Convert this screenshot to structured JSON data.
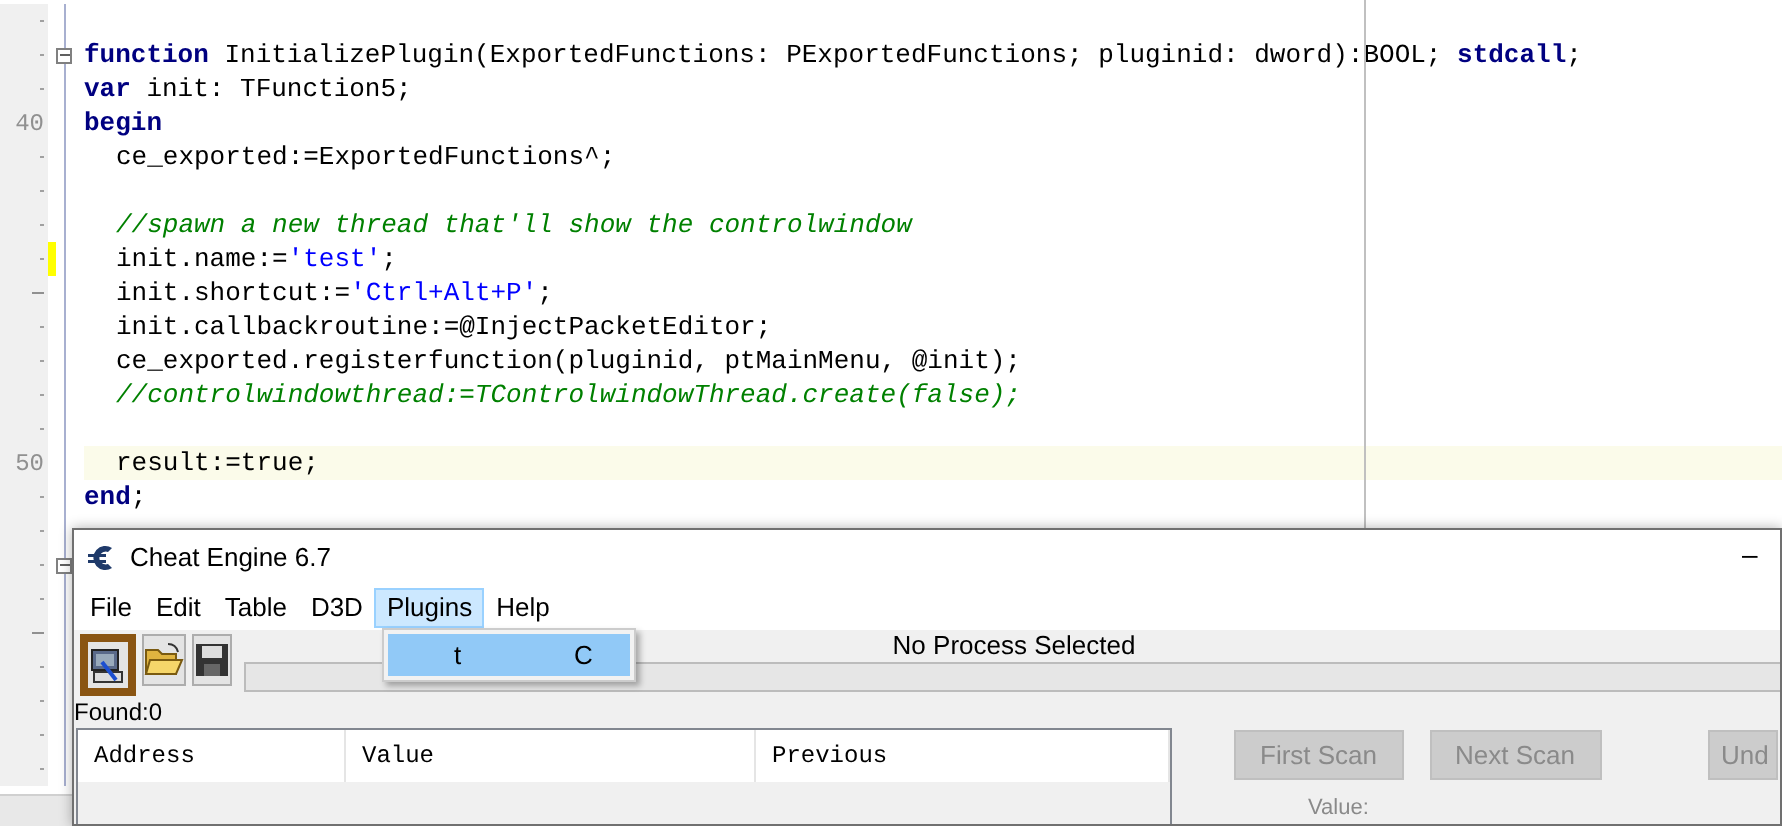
{
  "editor": {
    "lines": [
      {
        "kind": "dot"
      },
      {
        "kind": "dot",
        "fold": true,
        "tokens": [
          {
            "kind": "keyword",
            "text": "function"
          },
          {
            "kind": "plain",
            "text": " InitializePlugin(ExportedFunctions: PExportedFunctions; pluginid: dword):BOOL; "
          },
          {
            "kind": "keyword",
            "text": "stdcall"
          },
          {
            "kind": "plain",
            "text": ";"
          }
        ]
      },
      {
        "kind": "dot",
        "tokens": [
          {
            "kind": "keyword",
            "text": "var"
          },
          {
            "kind": "plain",
            "text": " init: TFunction5;"
          }
        ]
      },
      {
        "number": "40",
        "tokens": [
          {
            "kind": "keyword",
            "text": "begin"
          }
        ]
      },
      {
        "kind": "dot",
        "indented": true,
        "tokens": [
          {
            "kind": "plain",
            "text": "ce_exported:=ExportedFunctions^;"
          }
        ]
      },
      {
        "kind": "dot"
      },
      {
        "kind": "dot",
        "indented": true,
        "tokens": [
          {
            "kind": "comment",
            "text": "//spawn a new thread that'll show the controlwindow"
          }
        ]
      },
      {
        "kind": "dot",
        "indented": true,
        "modified": true,
        "tokens": [
          {
            "kind": "plain",
            "text": "init.name:="
          },
          {
            "kind": "string",
            "text": "'test'"
          },
          {
            "kind": "plain",
            "text": ";"
          }
        ]
      },
      {
        "kind": "dash",
        "indented": true,
        "tokens": [
          {
            "kind": "plain",
            "text": "init.shortcut:="
          },
          {
            "kind": "string",
            "text": "'Ctrl+Alt+P'"
          },
          {
            "kind": "plain",
            "text": ";"
          }
        ]
      },
      {
        "kind": "dot",
        "indented": true,
        "tokens": [
          {
            "kind": "plain",
            "text": "init.callbackroutine:=@InjectPacketEditor;"
          }
        ]
      },
      {
        "kind": "dot",
        "indented": true,
        "tokens": [
          {
            "kind": "plain",
            "text": "ce_exported.registerfunction(pluginid, ptMainMenu, @init);"
          }
        ]
      },
      {
        "kind": "dot",
        "indented": true,
        "tokens": [
          {
            "kind": "comment",
            "text": "//controlwindowthread:=TControlwindowThread.create(false);"
          }
        ]
      },
      {
        "kind": "dot"
      },
      {
        "number": "50",
        "indented": true,
        "current": true,
        "tokens": [
          {
            "kind": "plain",
            "text": "result:=true;"
          }
        ]
      },
      {
        "kind": "dot",
        "tokens": [
          {
            "kind": "keyword",
            "text": "end"
          },
          {
            "kind": "plain",
            "text": ";"
          }
        ]
      },
      {
        "kind": "dot"
      },
      {
        "kind": "dot",
        "fold": true
      },
      {
        "kind": "dot"
      },
      {
        "kind": "dash"
      },
      {
        "kind": "dot"
      },
      {
        "kind": "dot"
      },
      {
        "kind": "dot"
      },
      {
        "kind": "dot"
      }
    ]
  },
  "window": {
    "title": "Cheat Engine 6.7",
    "minimize": "–",
    "menu": [
      {
        "label": "File",
        "selected": false
      },
      {
        "label": "Edit",
        "selected": false
      },
      {
        "label": "Table",
        "selected": false
      },
      {
        "label": "D3D",
        "selected": false
      },
      {
        "label": "Plugins",
        "selected": true
      },
      {
        "label": "Help",
        "selected": false
      }
    ],
    "dropdown": [
      {
        "label": "t",
        "shortcut": "C",
        "selected": true
      }
    ],
    "toolbar": [
      {
        "kind": "process",
        "selected": true
      },
      {
        "kind": "open",
        "selected": false
      },
      {
        "kind": "save",
        "selected": false
      }
    ],
    "process": "No Process Selected",
    "progress": {
      "level": 0
    },
    "found": "Found:0",
    "columns": [
      "Address",
      "Value",
      "Previous"
    ],
    "buttons": [
      {
        "label": "First Scan",
        "disabled": true
      },
      {
        "label": "Next Scan",
        "disabled": true
      },
      {
        "label": "Und",
        "disabled": true
      }
    ],
    "value_label": "Value:"
  }
}
